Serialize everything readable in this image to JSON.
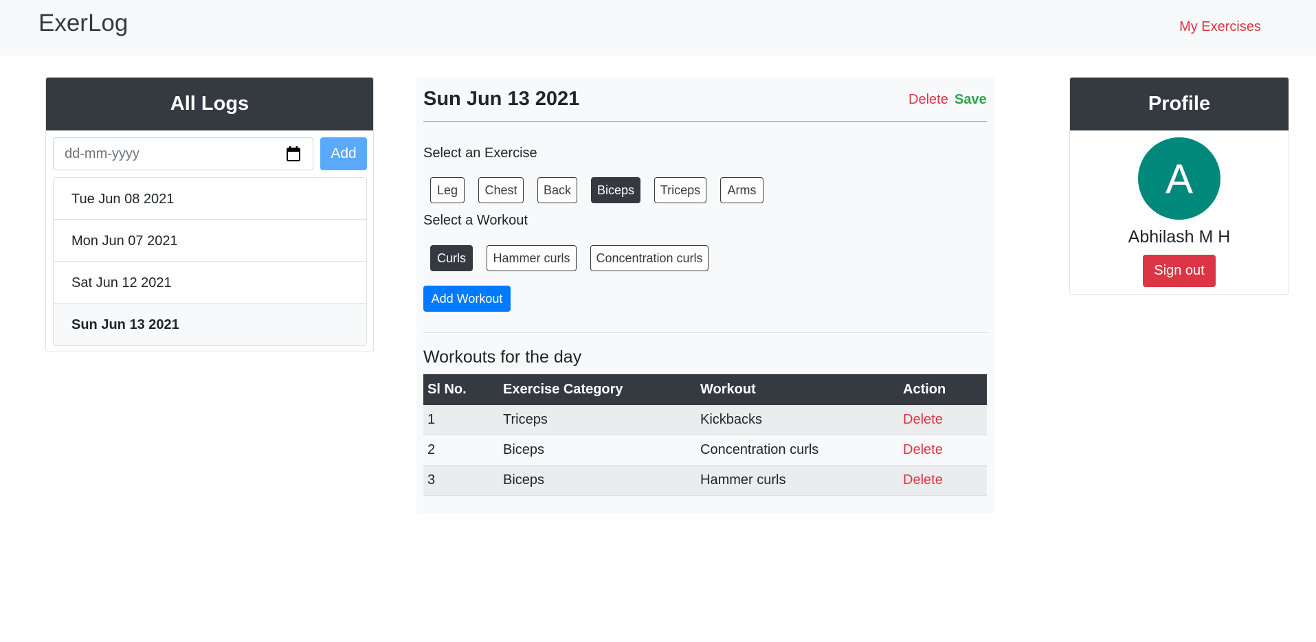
{
  "navbar": {
    "brand": "ExerLog",
    "link": "My Exercises"
  },
  "logs": {
    "title": "All Logs",
    "date_placeholder": "dd-mm-yyyy",
    "add_label": "Add",
    "items": [
      {
        "label": "Tue Jun 08 2021",
        "active": false
      },
      {
        "label": "Mon Jun 07 2021",
        "active": false
      },
      {
        "label": "Sat Jun 12 2021",
        "active": false
      },
      {
        "label": "Sun Jun 13 2021",
        "active": true
      }
    ]
  },
  "day": {
    "title": "Sun Jun 13 2021",
    "delete_label": "Delete",
    "save_label": "Save",
    "exercise_prompt": "Select an Exercise",
    "exercises": [
      "Leg",
      "Chest",
      "Back",
      "Biceps",
      "Triceps",
      "Arms"
    ],
    "selected_exercise": "Biceps",
    "workout_prompt": "Select a Workout",
    "workouts": [
      "Curls",
      "Hammer curls",
      "Concentration curls"
    ],
    "selected_workout": "Curls",
    "add_workout_label": "Add Workout",
    "table_title": "Workouts for the day",
    "columns": [
      "Sl No.",
      "Exercise Category",
      "Workout",
      "Action"
    ],
    "rows": [
      {
        "no": "1",
        "category": "Triceps",
        "workout": "Kickbacks",
        "action": "Delete"
      },
      {
        "no": "2",
        "category": "Biceps",
        "workout": "Concentration curls",
        "action": "Delete"
      },
      {
        "no": "3",
        "category": "Biceps",
        "workout": "Hammer curls",
        "action": "Delete"
      }
    ]
  },
  "profile": {
    "title": "Profile",
    "avatar_letter": "A",
    "name": "Abhilash M H",
    "signout_label": "Sign out"
  },
  "colors": {
    "navbar_bg": "#f8f9fa",
    "dark": "#343a40",
    "danger": "#dc3545",
    "success": "#28a745",
    "primary": "#007bff",
    "add_button": "#5aa9fb",
    "avatar": "#00897b"
  },
  "icons": {
    "date_picker": "calendar-icon"
  }
}
